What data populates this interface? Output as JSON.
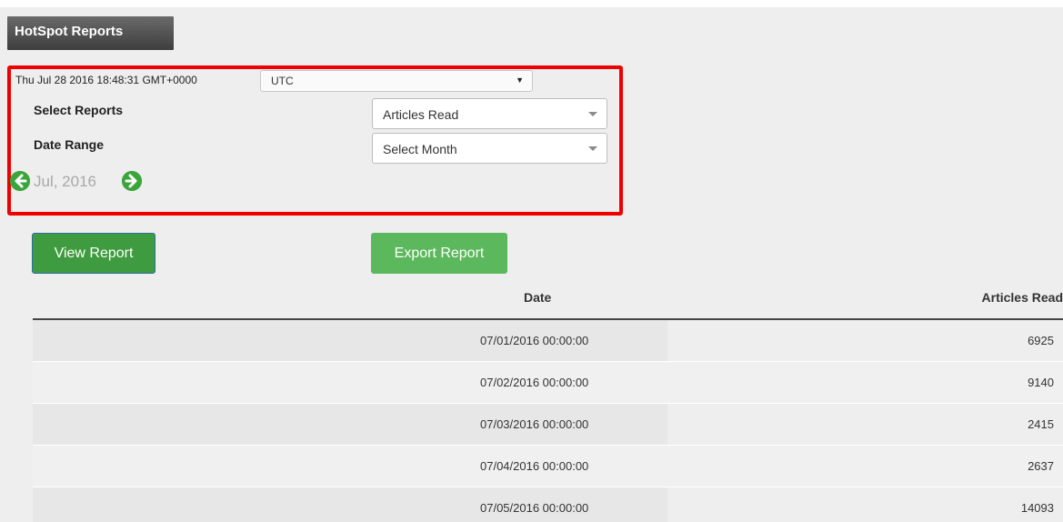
{
  "header": {
    "title": "HotSpot Reports"
  },
  "toolbar": {
    "clock": "Thu Jul 28 2016 18:48:31 GMT+0000",
    "timezone": {
      "value": "UTC",
      "arrow": "▼"
    }
  },
  "filters": {
    "report_label": "Select Reports",
    "report_value": "Articles Read",
    "range_label": "Date Range",
    "range_value": "Select Month",
    "month": "Jul, 2016",
    "prev_icon": "chevron-left-circle-icon",
    "next_icon": "chevron-right-circle-icon"
  },
  "actions": {
    "view_label": "View Report",
    "export_label": "Export Report"
  },
  "table": {
    "columns": [
      "Date",
      "Articles Read"
    ],
    "rows": [
      {
        "date": "07/01/2016 00:00:00",
        "value": "6925"
      },
      {
        "date": "07/02/2016 00:00:00",
        "value": "9140"
      },
      {
        "date": "07/03/2016 00:00:00",
        "value": "2415"
      },
      {
        "date": "07/04/2016 00:00:00",
        "value": "2637"
      },
      {
        "date": "07/05/2016 00:00:00",
        "value": "14093"
      }
    ]
  },
  "colors": {
    "accent_green": "#5cb85c",
    "highlight_red": "#ee0000",
    "title_bg": "#4a4a4a"
  }
}
